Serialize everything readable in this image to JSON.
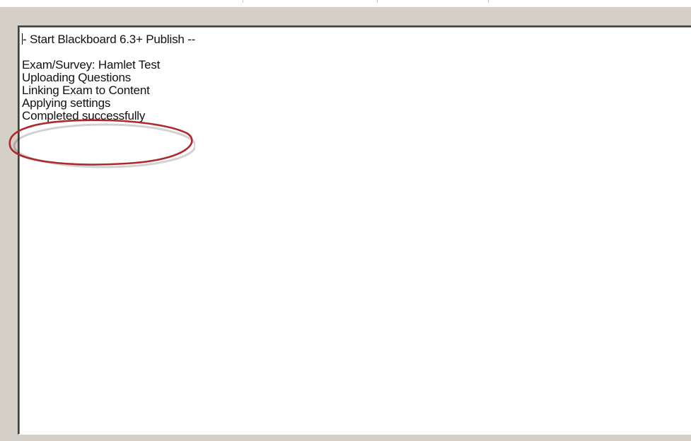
{
  "log": {
    "lines": [
      "- Start Blackboard 6.3+ Publish --",
      "",
      "Exam/Survey: Hamlet Test",
      "Uploading Questions",
      "Linking Exam to Content",
      "Applying settings",
      "Completed successfully"
    ]
  },
  "annotation": {
    "color": "#b0282b",
    "highlighted_line": "Completed successfully"
  }
}
